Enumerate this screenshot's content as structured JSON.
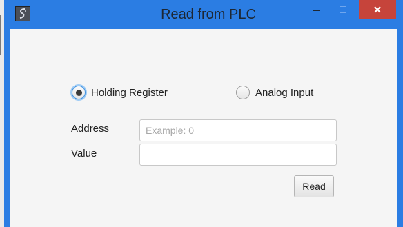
{
  "window": {
    "title": "Read from PLC",
    "accent_color": "#2b7de3",
    "close_color": "#c6443b"
  },
  "title_controls": [
    "minimize-icon",
    "maximize-icon",
    "close-icon"
  ],
  "register_type": {
    "options": [
      {
        "label": "Holding Register",
        "selected": true
      },
      {
        "label": "Analog Input",
        "selected": false
      }
    ]
  },
  "form": {
    "address_label": "Address",
    "address_value": "",
    "address_placeholder": "Example: 0",
    "value_label": "Value",
    "value_value": "",
    "value_placeholder": ""
  },
  "actions": {
    "read_label": "Read"
  }
}
